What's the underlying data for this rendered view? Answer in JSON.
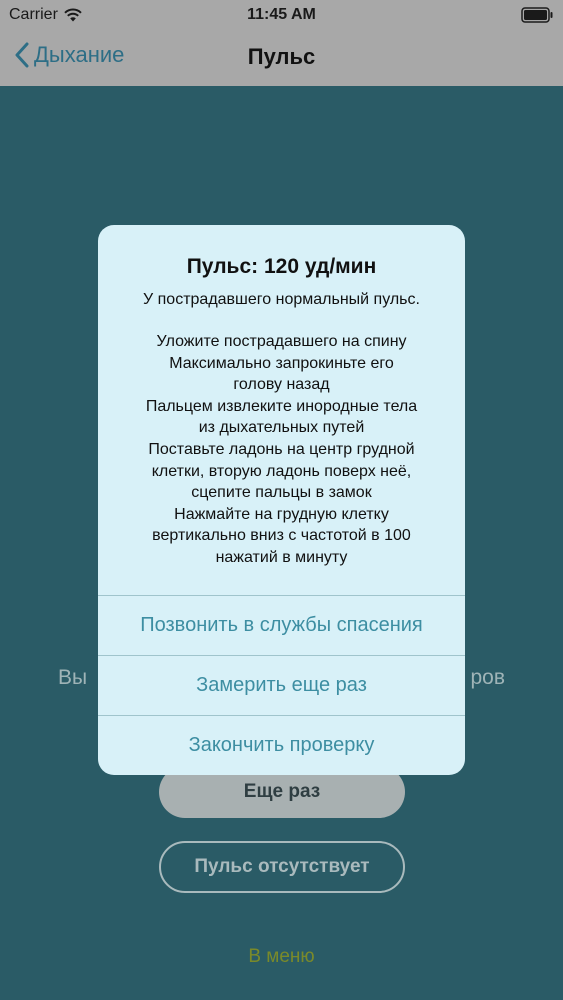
{
  "status_bar": {
    "carrier": "Carrier",
    "time": "11:45 AM"
  },
  "nav": {
    "back_label": "Дыхание",
    "title": "Пульс"
  },
  "background": {
    "partial_text_left": "Вы",
    "partial_text_right": "ров",
    "again_button": "Еще раз",
    "no_pulse_button": "Пульс отсутствует",
    "menu_link": "В меню"
  },
  "alert": {
    "title": "Пульс: 120 уд/мин",
    "subtitle": "У пострадавшего нормальный пульс.",
    "instructions": [
      "Уложите пострадавшего на спину",
      "Максимально запрокиньте его",
      "голову назад",
      "Пальцем извлеките инородные тела",
      "из дыхательных путей",
      "Поставьте ладонь на центр грудной",
      "клетки, вторую ладонь поверх неё,",
      "сцепите пальцы в замок",
      "Нажмайте на грудную клетку",
      "вертикально вниз с частотой в 100",
      "нажатий в минуту"
    ],
    "actions": [
      "Позвонить в службы спасения",
      "Замерить еще раз",
      "Закончить проверку"
    ]
  },
  "colors": {
    "background": "#2a5b66",
    "alert_background": "#d8f1f8",
    "action_text": "#3d8ea2",
    "menu_link": "#7a8a2a"
  },
  "icons": [
    "wifi-icon",
    "battery-icon",
    "chevron-left-icon"
  ]
}
